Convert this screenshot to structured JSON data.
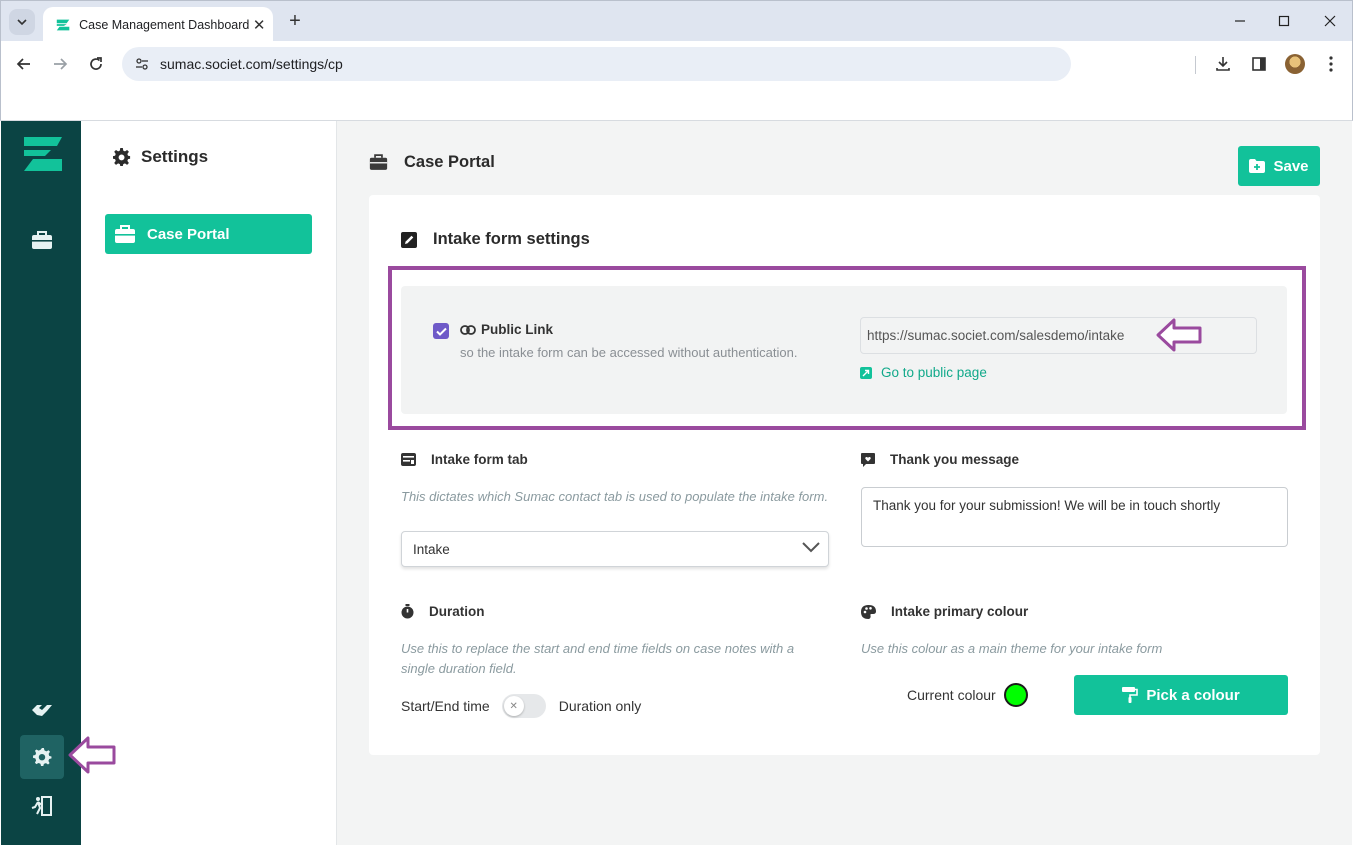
{
  "browser": {
    "tab_title": "Case Management Dashboard",
    "url": "sumac.societ.com/settings/cp"
  },
  "sidebar": {
    "title": "Settings",
    "items": [
      {
        "label": "Case Portal",
        "active": true
      }
    ]
  },
  "main": {
    "title": "Case Portal",
    "save_label": "Save",
    "card": {
      "title": "Intake form settings",
      "public_link": {
        "checked": true,
        "label": "Public Link",
        "description": "so the intake form can be accessed without authentication.",
        "url_value": "https://sumac.societ.com/salesdemo/intake",
        "goto_label": "Go to public page"
      },
      "intake_tab": {
        "title": "Intake form tab",
        "description": "This dictates which Sumac contact tab is used to populate the intake form.",
        "selected": "Intake"
      },
      "thank_you": {
        "title": "Thank you message",
        "value": "Thank you for your submission! We will be in touch shortly"
      },
      "duration": {
        "title": "Duration",
        "description": "Use this to replace the start and end time fields on case notes with a single duration field.",
        "left_label": "Start/End time",
        "right_label": "Duration only",
        "enabled": false
      },
      "colour": {
        "title": "Intake primary colour",
        "description": "Use this colour as a main theme for your intake form",
        "current_label": "Current colour",
        "current_value": "#00ff00",
        "pick_label": "Pick a colour"
      }
    }
  },
  "colors": {
    "accent": "#12c29a",
    "rail": "#0b4444",
    "annotation": "#9a4a9e",
    "checkbox": "#6f5ac8"
  }
}
